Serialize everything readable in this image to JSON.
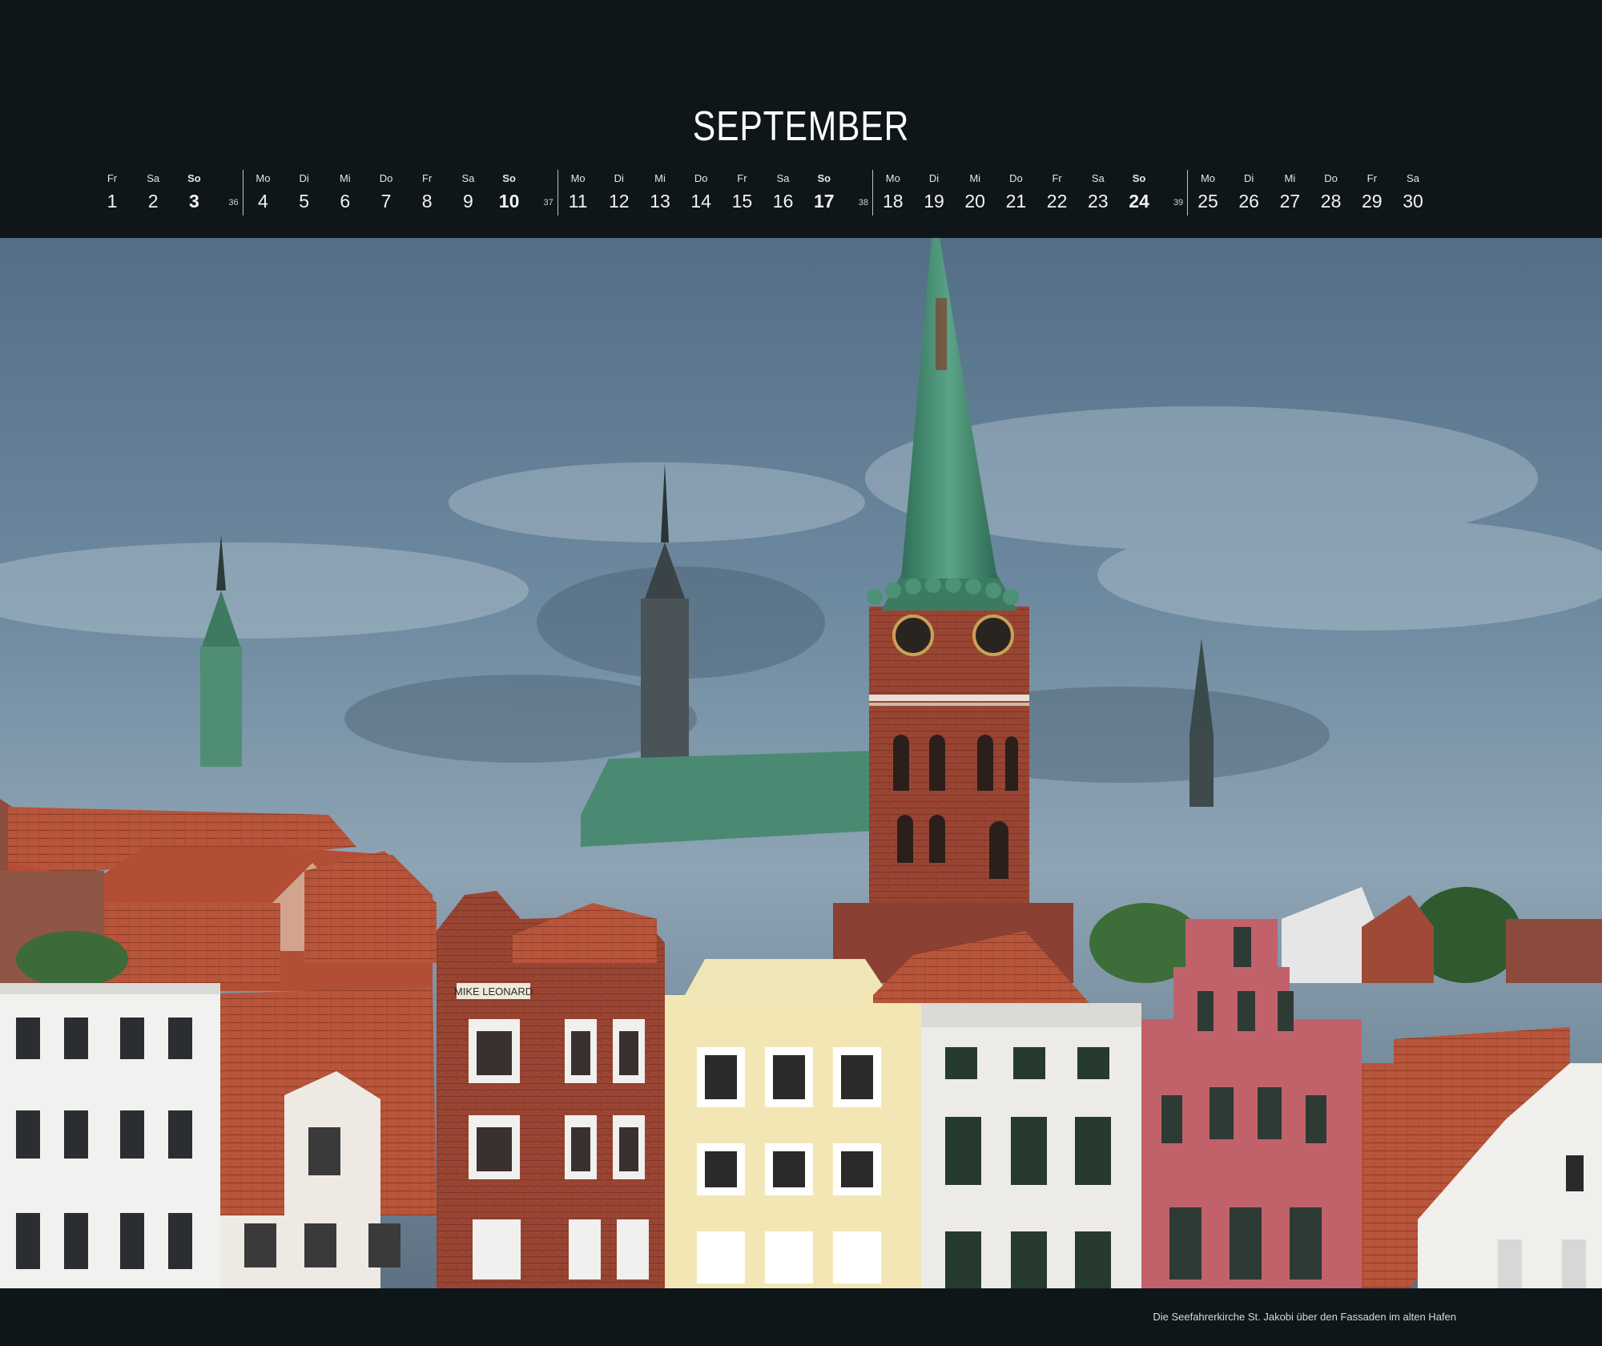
{
  "month": "SEPTEMBER",
  "days": [
    {
      "name": "Fr",
      "date": "1",
      "sunday": false
    },
    {
      "name": "Sa",
      "date": "2",
      "sunday": false
    },
    {
      "name": "So",
      "date": "3",
      "sunday": true
    },
    {
      "name": "Mo",
      "date": "4",
      "sunday": false
    },
    {
      "name": "Di",
      "date": "5",
      "sunday": false
    },
    {
      "name": "Mi",
      "date": "6",
      "sunday": false
    },
    {
      "name": "Do",
      "date": "7",
      "sunday": false
    },
    {
      "name": "Fr",
      "date": "8",
      "sunday": false
    },
    {
      "name": "Sa",
      "date": "9",
      "sunday": false
    },
    {
      "name": "So",
      "date": "10",
      "sunday": true
    },
    {
      "name": "Mo",
      "date": "11",
      "sunday": false
    },
    {
      "name": "Di",
      "date": "12",
      "sunday": false
    },
    {
      "name": "Mi",
      "date": "13",
      "sunday": false
    },
    {
      "name": "Do",
      "date": "14",
      "sunday": false
    },
    {
      "name": "Fr",
      "date": "15",
      "sunday": false
    },
    {
      "name": "Sa",
      "date": "16",
      "sunday": false
    },
    {
      "name": "So",
      "date": "17",
      "sunday": true
    },
    {
      "name": "Mo",
      "date": "18",
      "sunday": false
    },
    {
      "name": "Di",
      "date": "19",
      "sunday": false
    },
    {
      "name": "Mi",
      "date": "20",
      "sunday": false
    },
    {
      "name": "Do",
      "date": "21",
      "sunday": false
    },
    {
      "name": "Fr",
      "date": "22",
      "sunday": false
    },
    {
      "name": "Sa",
      "date": "23",
      "sunday": false
    },
    {
      "name": "So",
      "date": "24",
      "sunday": true
    },
    {
      "name": "Mo",
      "date": "25",
      "sunday": false
    },
    {
      "name": "Di",
      "date": "26",
      "sunday": false
    },
    {
      "name": "Mi",
      "date": "27",
      "sunday": false
    },
    {
      "name": "Do",
      "date": "28",
      "sunday": false
    },
    {
      "name": "Fr",
      "date": "29",
      "sunday": false
    },
    {
      "name": "Sa",
      "date": "30",
      "sunday": false
    }
  ],
  "week_numbers": [
    "36",
    "37",
    "38",
    "39"
  ],
  "photo": {
    "sign_text": "MIKE LEONARD"
  },
  "caption": "Die Seefahrerkirche St. Jakobi über den Fassaden im alten Hafen",
  "colors": {
    "background": "#0f1619",
    "sky": "#6f8596",
    "copper": "#4e9479",
    "brick": "#9c4432",
    "roof": "#c15a3a"
  }
}
